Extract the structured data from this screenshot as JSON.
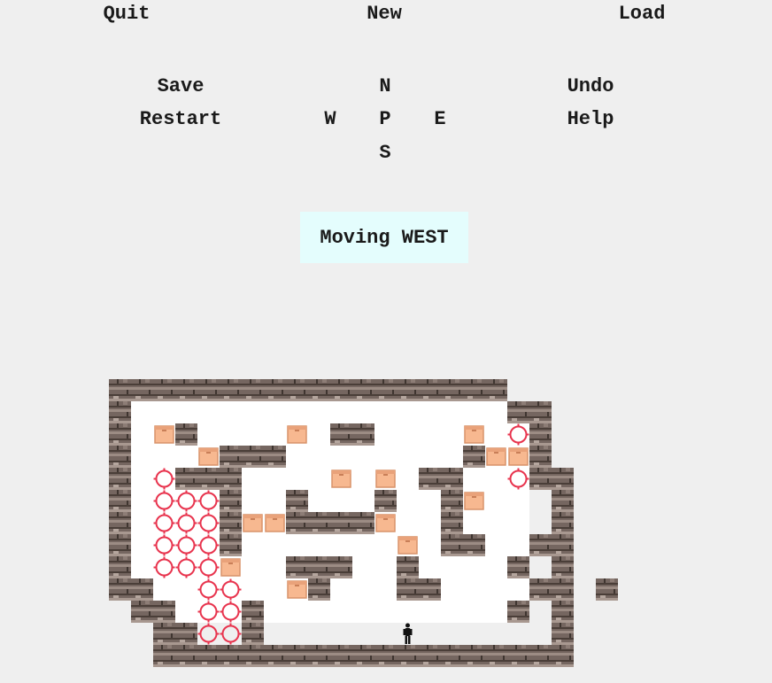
{
  "menu": {
    "quit": "Quit",
    "new": "New",
    "load": "Load",
    "save": "Save",
    "restart": "Restart",
    "undo": "Undo",
    "help": "Help"
  },
  "dpad": {
    "north": "N",
    "west": "W",
    "center": "P",
    "east": "E",
    "south": "S"
  },
  "status": "Moving WEST",
  "colors": {
    "background": "#efefef",
    "status_bg": "#e4fdfd",
    "wall": "#7a6a62",
    "floor": "#ffffff",
    "box": "#f7b890",
    "goal": "#e8344e",
    "player": "#111111"
  },
  "level": [
    "##################  ",
    "#                 ##",
    "# $#    $ ##    $ .#",
    "#   $###        #$$#",
    "# .###    $ $ ##  .##",
    "# ...#  #   #  #$   #",
    "# ...#$$####$  #    #",
    "# ...#       $ ##  ##",
    "# ...$  ###  #    # #",
    "##  ..  $#   ##    ## #",
    " ## ..#           # #",
    "  ##..#      @      #",
    "  ###################"
  ]
}
